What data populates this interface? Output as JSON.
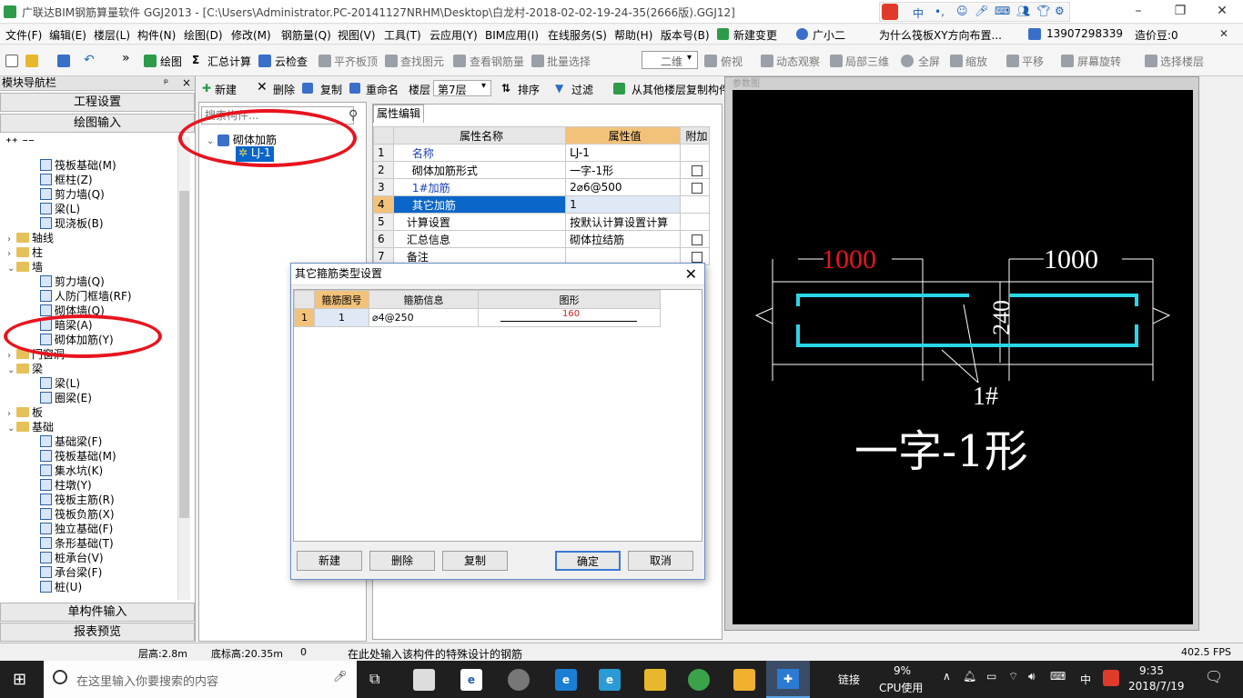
{
  "title_bar": {
    "title": "广联达BIM钢筋算量软件 GGJ2013 - [C:\\Users\\Administrator.PC-20141127NRHM\\Desktop\\白龙村-2018-02-02-19-24-35(2666版).GGJ12]",
    "ime_badge": "中"
  },
  "menu": {
    "items": [
      "文件(F)",
      "编辑(E)",
      "楼层(L)",
      "构件(N)",
      "绘图(D)",
      "修改(M)",
      "钢筋量(Q)",
      "视图(V)",
      "工具(T)",
      "云应用(Y)",
      "BIM应用(I)",
      "在线服务(S)",
      "帮助(H)",
      "版本号(B)",
      "新建变更",
      "广小二"
    ],
    "ad_text": "为什么筏板XY方向布置...",
    "phone": "13907298339",
    "points": "造价豆:0"
  },
  "toolbar": {
    "draw": "绘图",
    "sum": "汇总计算",
    "cloud_check": "云检查",
    "flat_top": "平齐板顶",
    "find_elem": "查找图元",
    "view_rebar": "查看钢筋量",
    "batch_select": "批量选择",
    "view_mode": "二维",
    "top_view": "俯视",
    "dynamic": "动态观察",
    "local3d": "局部三维",
    "fullscreen": "全屏",
    "zoom": "缩放",
    "pan": "平移",
    "rotate": "屏幕旋转",
    "select_floor": "选择楼层"
  },
  "left_panel": {
    "header": "模块导航栏",
    "pin": "ᵖ",
    "close": "×",
    "btn_project": "工程设置",
    "btn_draw": "绘图输入",
    "btn_single": "单构件输入",
    "btn_report": "报表预览",
    "tree": [
      {
        "label": "筏板基础(M)",
        "indent": 2,
        "type": "item"
      },
      {
        "label": "框柱(Z)",
        "indent": 2,
        "type": "item"
      },
      {
        "label": "剪力墙(Q)",
        "indent": 2,
        "type": "item"
      },
      {
        "label": "梁(L)",
        "indent": 2,
        "type": "item"
      },
      {
        "label": "现浇板(B)",
        "indent": 2,
        "type": "item"
      },
      {
        "label": "轴线",
        "indent": 1,
        "type": "folder",
        "expander": "›"
      },
      {
        "label": "柱",
        "indent": 1,
        "type": "folder",
        "expander": "›"
      },
      {
        "label": "墙",
        "indent": 1,
        "type": "folder",
        "expander": "⌄"
      },
      {
        "label": "剪力墙(Q)",
        "indent": 2,
        "type": "item"
      },
      {
        "label": "人防门框墙(RF)",
        "indent": 2,
        "type": "item"
      },
      {
        "label": "砌体墙(Q)",
        "indent": 2,
        "type": "item"
      },
      {
        "label": "暗梁(A)",
        "indent": 2,
        "type": "item"
      },
      {
        "label": "砌体加筋(Y)",
        "indent": 2,
        "type": "item"
      },
      {
        "label": "门窗洞",
        "indent": 1,
        "type": "folder",
        "expander": "›"
      },
      {
        "label": "梁",
        "indent": 1,
        "type": "folder",
        "expander": "⌄"
      },
      {
        "label": "梁(L)",
        "indent": 2,
        "type": "item"
      },
      {
        "label": "圈梁(E)",
        "indent": 2,
        "type": "item"
      },
      {
        "label": "板",
        "indent": 1,
        "type": "folder",
        "expander": "›"
      },
      {
        "label": "基础",
        "indent": 1,
        "type": "folder",
        "expander": "⌄"
      },
      {
        "label": "基础梁(F)",
        "indent": 2,
        "type": "item"
      },
      {
        "label": "筏板基础(M)",
        "indent": 2,
        "type": "item"
      },
      {
        "label": "集水坑(K)",
        "indent": 2,
        "type": "item"
      },
      {
        "label": "柱墩(Y)",
        "indent": 2,
        "type": "item"
      },
      {
        "label": "筏板主筋(R)",
        "indent": 2,
        "type": "item"
      },
      {
        "label": "筏板负筋(X)",
        "indent": 2,
        "type": "item"
      },
      {
        "label": "独立基础(F)",
        "indent": 2,
        "type": "item"
      },
      {
        "label": "条形基础(T)",
        "indent": 2,
        "type": "item"
      },
      {
        "label": "桩承台(V)",
        "indent": 2,
        "type": "item"
      },
      {
        "label": "承台梁(F)",
        "indent": 2,
        "type": "item"
      },
      {
        "label": "桩(U)",
        "indent": 2,
        "type": "item"
      }
    ]
  },
  "component_bar": {
    "new": "新建",
    "delete": "删除",
    "copy": "复制",
    "rename": "重命名",
    "floor_label": "楼层",
    "floor_value": "第7层",
    "sort": "排序",
    "filter": "过滤",
    "copy_from": "从其他楼层复制构件"
  },
  "mid_panel": {
    "search_placeholder": "搜索构件...",
    "tree_root": "砌体加筋",
    "tree_child": "LJ-1"
  },
  "prop_grid": {
    "tab": "属性编辑",
    "headers": {
      "name": "属性名称",
      "value": "属性值",
      "extra": "附加"
    },
    "rows": [
      {
        "num": "1",
        "name": "名称",
        "value": "LJ-1",
        "check": false,
        "blue": true
      },
      {
        "num": "2",
        "name": "砌体加筋形式",
        "value": "一字-1形",
        "check": true,
        "blue": false
      },
      {
        "num": "3",
        "name": "1#加筋",
        "value": "2⌀6@500",
        "check": true,
        "blue": true
      },
      {
        "num": "4",
        "name": "其它加筋",
        "value": "1",
        "check": false,
        "blue": true,
        "selected": true
      },
      {
        "num": "5",
        "name": "计算设置",
        "value": "按默认计算设置计算",
        "check": false,
        "blue": false
      },
      {
        "num": "6",
        "name": "汇总信息",
        "value": "砌体拉结筋",
        "check": true,
        "blue": false
      },
      {
        "num": "7",
        "name": "备注",
        "value": "",
        "check": true,
        "blue": false
      }
    ]
  },
  "preview": {
    "label": "参数图",
    "dim_left": "1000",
    "dim_right": "1000",
    "dim_height": "240",
    "bar_label": "1#",
    "shape_caption": "一字-1形"
  },
  "dialog": {
    "title": "其它箍筋类型设置",
    "close": "✕",
    "headers": [
      "箍筋图号",
      "箍筋信息",
      "图形"
    ],
    "rows": [
      {
        "num": "1",
        "code": "1",
        "info": "⌀4@250",
        "shape_value": "160"
      }
    ],
    "btn_new": "新建",
    "btn_delete": "删除",
    "btn_copy": "复制",
    "btn_ok": "确定",
    "btn_cancel": "取消"
  },
  "status_bar": {
    "floor_height": "层高:2.8m",
    "base_height": "底标高:20.35m",
    "zero": "0",
    "hint": "在此处输入该构件的特殊设计的钢筋",
    "fps": "402.5 FPS"
  },
  "taskbar": {
    "search_placeholder": "在这里输入你要搜索的内容",
    "network": "链接",
    "cpu_pct": "9%",
    "cpu_label": "CPU使用",
    "ime": "中",
    "time": "9:35",
    "date": "2018/7/19"
  },
  "colors": {
    "selected_row": "#0a66c8",
    "header_value": "#f3c27a",
    "annotation_red": "#e8141e",
    "rebar_cyan": "#2ad6e8"
  }
}
